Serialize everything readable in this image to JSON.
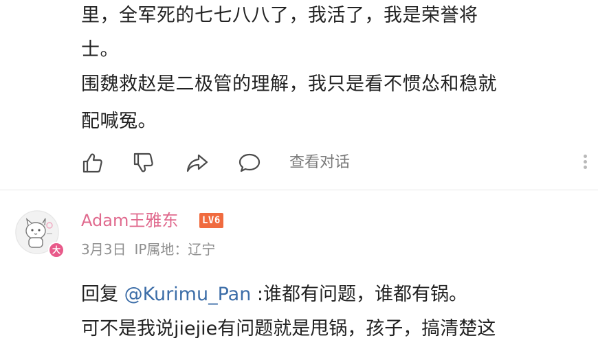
{
  "comment": {
    "lines": [
      "里，全军死的七七八八了，我活了，我是荣誉将",
      "士。",
      "围魏救赵是二极管的理解，我只是看不惯怂和稳就",
      "配喊冤。"
    ],
    "actions": {
      "like_icon": "thumbs-up-icon",
      "dislike_icon": "thumbs-down-icon",
      "share_icon": "share-icon",
      "reply_icon": "comment-icon",
      "view_conversation": "查看对话",
      "more_icon": "more-vertical-icon"
    }
  },
  "reply": {
    "username": "Adam王雅东",
    "level": "LV6",
    "avatar_badge": "大",
    "date": "3月3日",
    "ip_location": "IP属地：辽宁",
    "prefix": "回复 ",
    "mention": "@Kurimu_Pan",
    "line1_rest": " :谁都有问题，谁都有锅。",
    "line2": "可不是我说jiejie有问题就是甩锅，孩子，搞清楚这"
  },
  "colors": {
    "username": "#e06a8e",
    "mention": "#3d6ea8",
    "level_badge": "#f06b3f",
    "muted": "#8f8f8f"
  }
}
